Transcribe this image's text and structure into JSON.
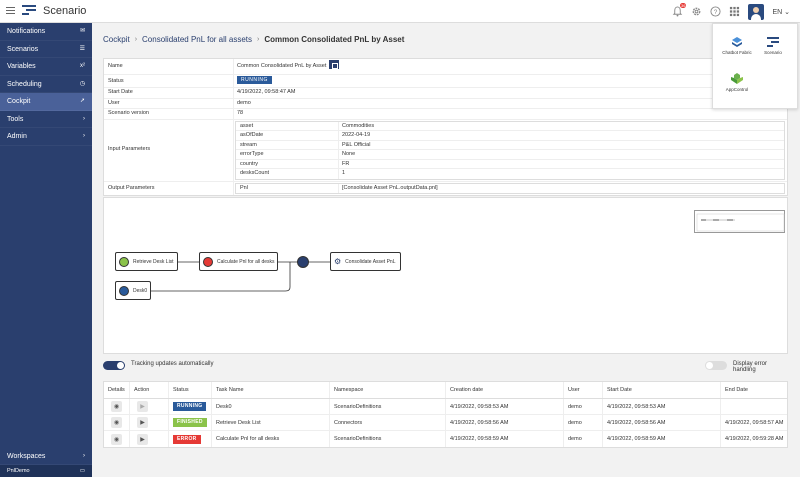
{
  "header": {
    "app_name": "Scenario",
    "notifications_count": "36",
    "language": "EN"
  },
  "sidebar": {
    "items": [
      {
        "label": "Notifications",
        "icon": "envelope-icon"
      },
      {
        "label": "Scenarios",
        "icon": "list-icon"
      },
      {
        "label": "Variables",
        "icon": "variable-icon"
      },
      {
        "label": "Scheduling",
        "icon": "clock-icon"
      },
      {
        "label": "Cockpit",
        "icon": "rocket-icon"
      },
      {
        "label": "Tools",
        "icon": "chevron-right-icon"
      },
      {
        "label": "Admin",
        "icon": "chevron-right-icon"
      }
    ],
    "workspaces": "Workspaces",
    "user": "PnlDemo"
  },
  "breadcrumb": {
    "item1": "Cockpit",
    "item2": "Consolidated PnL for all assets",
    "current": "Common Consolidated PnL by Asset"
  },
  "details": {
    "name_label": "Name",
    "name_value": "Common Consolidated PnL by Asset",
    "status_label": "Status",
    "status_value": "RUNNING",
    "start_label": "Start Date",
    "start_value": "4/19/2022, 09:58:47 AM",
    "user_label": "User",
    "user_value": "demo",
    "version_label": "Scenario version",
    "version_value": "78",
    "input_label": "Input Parameters",
    "input_params": [
      {
        "key": "asset",
        "value": "Commodities"
      },
      {
        "key": "asOfDate",
        "value": "2022-04-19"
      },
      {
        "key": "stream",
        "value": "P&L Official"
      },
      {
        "key": "errorType",
        "value": "None"
      },
      {
        "key": "country",
        "value": "FR"
      },
      {
        "key": "desksCount",
        "value": "1"
      }
    ],
    "output_label": "Output Parameters",
    "output_params": [
      {
        "key": "Pnl",
        "value": "[Consolidate Asset PnL.outputData.pnl]"
      }
    ]
  },
  "graph": {
    "nodes": [
      {
        "label": "Retrieve Desk List",
        "color": "#8bc34a"
      },
      {
        "label": "Calculate Pnl for all desks",
        "color": "#e53935"
      },
      {
        "label": "",
        "color": "#2a3f6e"
      },
      {
        "label": "Consolidate Asset PnL",
        "color": "#2a3f6e"
      },
      {
        "label": "Desk0",
        "color": "#2a5a9a"
      }
    ]
  },
  "toggles": {
    "tracking_label": "Tracking updates automatically",
    "tracking_on": true,
    "error_label": "Display error handling",
    "error_on": false
  },
  "tasks": {
    "columns": [
      "Details",
      "Action",
      "Status",
      "Task Name",
      "Namespace",
      "Creation date",
      "User",
      "Start Date",
      "End Date"
    ],
    "rows": [
      {
        "status": "RUNNING",
        "status_color": "#2a5a9a",
        "task": "Desk0",
        "namespace": "ScenarioDefinitions",
        "created": "4/19/2022, 09:58:53 AM",
        "user": "demo",
        "start": "4/19/2022, 09:58:53 AM",
        "end": ""
      },
      {
        "status": "FINISHED",
        "status_color": "#8bc34a",
        "task": "Retrieve Desk List",
        "namespace": "Connectors",
        "created": "4/19/2022, 09:58:56 AM",
        "user": "demo",
        "start": "4/19/2022, 09:58:56 AM",
        "end": "4/19/2022, 09:58:57 AM"
      },
      {
        "status": "ERROR",
        "status_color": "#e53935",
        "task": "Calculate Pnl for all desks",
        "namespace": "ScenarioDefinitions",
        "created": "4/19/2022, 09:58:59 AM",
        "user": "demo",
        "start": "4/19/2022, 09:58:59 AM",
        "end": "4/19/2022, 09:59:28 AM"
      }
    ]
  },
  "apps_menu": {
    "app1": "Chatbot Fabric",
    "app2": "Scenario",
    "app3": "AppControl"
  }
}
